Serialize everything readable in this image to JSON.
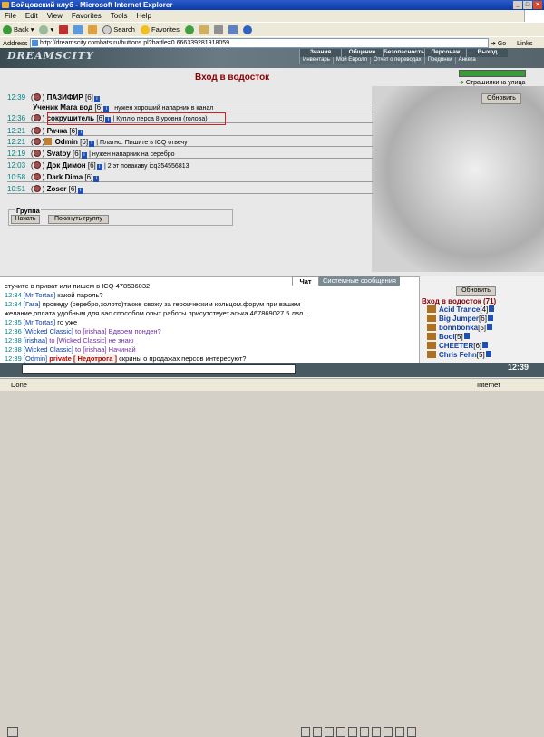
{
  "window": {
    "title": "Бойцовский клуб - Microsoft Internet Explorer"
  },
  "menu": [
    "File",
    "Edit",
    "View",
    "Favorites",
    "Tools",
    "Help"
  ],
  "toolbar": {
    "back": "Back",
    "search": "Search",
    "favorites": "Favorites"
  },
  "address": {
    "label": "Address",
    "url": "http://dreamscity.combats.ru/buttons.pl?battle=0.666339281918059",
    "go": "Go",
    "links": "Links"
  },
  "game": {
    "logo": "DREAMSCITY",
    "nav_top": [
      "Знания",
      "Общение",
      "Безопасность",
      "Персонаж",
      "Выход"
    ],
    "nav_sub": [
      "Инвентарь",
      "Мой Евролл",
      "Отчет о переводах",
      "Поединки",
      "Анкета"
    ]
  },
  "room": {
    "title": "Вход в водосток",
    "street": "Страшилкина улица",
    "refresh": "Обновить",
    "hp_fraction": 1.0
  },
  "players": [
    {
      "time": "12:39",
      "nick": "ПАЗИФИР",
      "level": "[6]",
      "msg": ""
    },
    {
      "time": "",
      "nick": "Ученик Мага вод",
      "level": "[6]",
      "msg": "| нужен хороший напарник в канал"
    },
    {
      "time": "12:36",
      "nick": "сокрушитель",
      "level": "[6]",
      "msg": "| Куплю перса 8 уровня (голова)"
    },
    {
      "time": "12:21",
      "nick": "Рачка",
      "level": "[6]",
      "msg": ""
    },
    {
      "time": "12:21",
      "nick": "Odmin",
      "level": "[6]",
      "msg": "| Платно. Пишите в ICQ отвечу"
    },
    {
      "time": "12:19",
      "nick": "Svatoy",
      "level": "[6]",
      "msg": "| нужен напарник на серебро"
    },
    {
      "time": "12:03",
      "nick": "Док Димон",
      "level": "[6]",
      "msg": "| 2 эт повакаву icq354556813"
    },
    {
      "time": "10:58",
      "nick": "Dark Dima",
      "level": "[6]",
      "msg": ""
    },
    {
      "time": "10:51",
      "nick": "Zoser",
      "level": "[6]",
      "msg": ""
    }
  ],
  "group": {
    "label": "Группа",
    "start": "Начать",
    "leave": "Покинуть группу"
  },
  "chat": {
    "tab_chat": "Чат",
    "tab_system": "Системные сообщения",
    "lines": [
      {
        "time": "",
        "from": "",
        "text": "стучите в приват или пишем в ICQ 478536032"
      },
      {
        "time": "12:34",
        "from": "[Mr Tortas]",
        "text": "какой пароль?"
      },
      {
        "time": "12:34",
        "from": "[Гага]",
        "text": "проведу (серебро,золото)также свожу за героическим кольцом.форум при вашем"
      },
      {
        "time": "",
        "from": "",
        "text": "желание,оплата удобным для вас способом.опыт работы присутствует.аська 467869027 5 лвл ."
      },
      {
        "time": "12:35",
        "from": "[Mr Tortas]",
        "text": "го уже"
      },
      {
        "time": "12:36",
        "from": "[Wicked Classic]",
        "text": "to [irishaa] Вдвоем понден?"
      },
      {
        "time": "12:38",
        "from": "[irishaa]",
        "text": "to [Wicked Classic] не знаю"
      },
      {
        "time": "12:38",
        "from": "[Wicked Classic]",
        "text": "to [irishaa] Начинай"
      },
      {
        "time": "12:39",
        "from": "[Odmin]",
        "text": "скрины о продажах персов интересуют?"
      }
    ],
    "private_label": "private",
    "private_to": "[ Недотрога ]"
  },
  "room_list": {
    "refresh": "Обновить",
    "title": "Вход в водосток (71)",
    "players": [
      {
        "nick": "Acid Trance",
        "level": "[4]"
      },
      {
        "nick": "Big Jumper",
        "level": "[6]"
      },
      {
        "nick": "bonnbonka",
        "level": "[5]"
      },
      {
        "nick": "Bool",
        "level": "[5]"
      },
      {
        "nick": "CHEETER",
        "level": "[6]"
      },
      {
        "nick": "Chris Fehn",
        "level": "[5]"
      }
    ]
  },
  "clock": "12:39",
  "status": {
    "text": "Done",
    "zone": "Internet"
  }
}
